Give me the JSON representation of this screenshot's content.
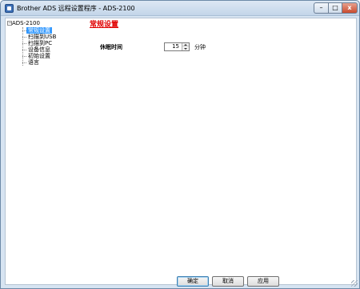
{
  "window": {
    "title": "Brother ADS 远程设置程序 - ADS-2100",
    "minimize_glyph": "–",
    "maximize_glyph": "□",
    "close_glyph": "x"
  },
  "tree": {
    "root_label": "ADS-2100",
    "expander_glyph": "−",
    "items": [
      {
        "label": "常规设置",
        "selected": true
      },
      {
        "label": "扫描到USB",
        "selected": false
      },
      {
        "label": "扫描到PC",
        "selected": false
      },
      {
        "label": "设备信息",
        "selected": false
      },
      {
        "label": "初始设置",
        "selected": false
      },
      {
        "label": "语言",
        "selected": false
      }
    ]
  },
  "main": {
    "section_title": "常规设置",
    "sleep_time": {
      "label": "休眠时间",
      "value": "15",
      "unit": "分钟"
    }
  },
  "footer": {
    "ok_label": "确定",
    "cancel_label": "取消",
    "apply_label": "应用"
  },
  "colors": {
    "section_title": "#e00000",
    "selection": "#3399ff",
    "title_bar": "#c3d5e9",
    "close_button": "#c94a2e"
  }
}
